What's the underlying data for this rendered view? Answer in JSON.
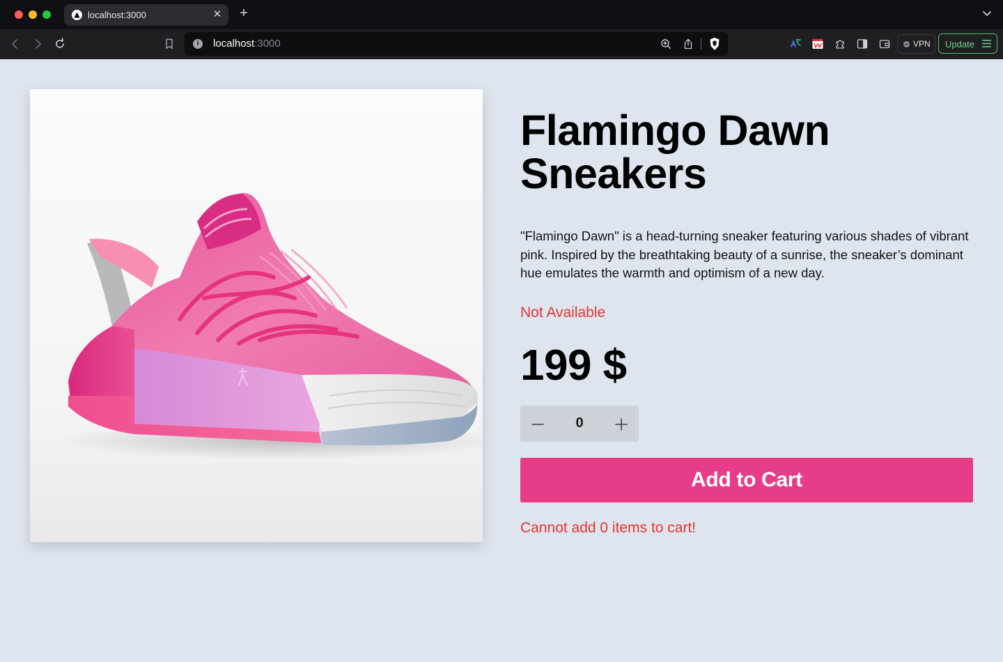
{
  "browser": {
    "tab_title": "localhost:3000",
    "url_host": "localhost",
    "url_port": ":3000",
    "vpn_label": "VPN",
    "update_label": "Update",
    "icons": {
      "back": "chevron-left-icon",
      "forward": "chevron-right-icon",
      "reload": "reload-icon",
      "bookmark": "bookmark-icon",
      "zoom": "zoom-icon",
      "share": "share-icon",
      "shield": "brave-shield-icon"
    }
  },
  "product": {
    "title": "Flamingo Dawn Sneakers",
    "description": "\"Flamingo Dawn\" is a head-turning sneaker featuring various shades of vibrant pink. Inspired by the breathtaking beauty of a sunrise, the sneaker’s dominant hue emulates the warmth and optimism of a new day.",
    "availability": "Not Available",
    "price": "199 $",
    "quantity": "0",
    "add_to_cart_label": "Add to Cart",
    "error_message": "Cannot add 0 items to cart!"
  },
  "colors": {
    "page_background": "#dfe5ef",
    "accent": "#e73c88",
    "error": "#e3342f",
    "stepper_background": "#cdd2d9"
  }
}
